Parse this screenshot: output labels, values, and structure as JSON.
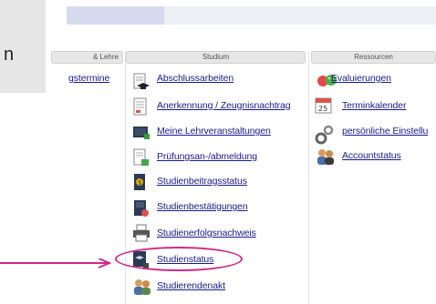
{
  "sidebar": {
    "partial_text": "n"
  },
  "columns": {
    "col1_header": "& Lehre",
    "col2_header": "Studium",
    "col3_header": "Ressourcen"
  },
  "col1": {
    "items": [
      {
        "label": "gstermine"
      }
    ]
  },
  "studium": {
    "items": [
      {
        "label": "Abschlussarbeiten",
        "icon": "graduation-cap-icon"
      },
      {
        "label": "Anerkennung / Zeugnisnachtrag",
        "icon": "document-icon"
      },
      {
        "label": "Meine Lehrveranstaltungen",
        "icon": "book-icon"
      },
      {
        "label": "Prüfungsan-/abmeldung",
        "icon": "exam-document-icon"
      },
      {
        "label": "Studienbeitragsstatus",
        "icon": "fee-status-icon"
      },
      {
        "label": "Studienbestätigungen",
        "icon": "certificate-icon"
      },
      {
        "label": "Studienerfolgsnachweis",
        "icon": "printer-icon"
      },
      {
        "label": "Studienstatus",
        "icon": "student-status-icon"
      },
      {
        "label": "Studierendenakt",
        "icon": "people-icon"
      }
    ]
  },
  "ressourcen": {
    "items": [
      {
        "label": "Evaluierungen",
        "icon": "smiley-faces-icon"
      },
      {
        "label": "Terminkalender",
        "icon": "calendar-icon"
      },
      {
        "label": "persönliche Einstellu",
        "icon": "gears-icon"
      },
      {
        "label": "Accountstatus",
        "icon": "users-icon"
      }
    ],
    "calendar_day": "25"
  },
  "annotation": {
    "highlight_color": "#cf2a8a"
  }
}
